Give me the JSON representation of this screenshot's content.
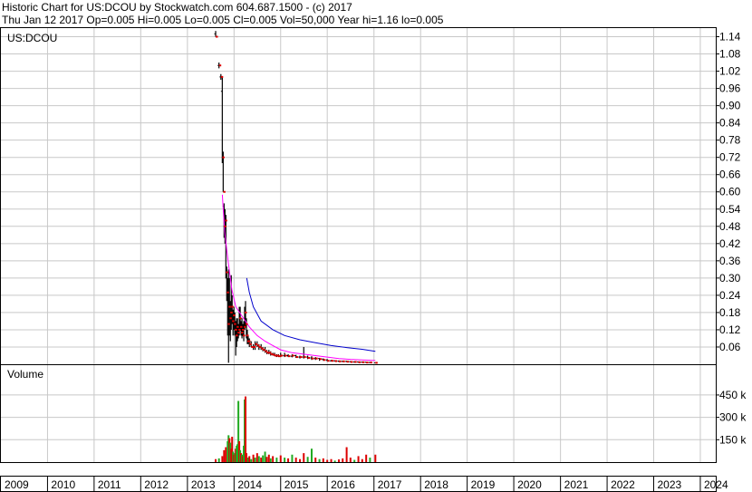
{
  "header": {
    "line1": "Historic Chart for US:DCOU by Stockwatch.com 604.687.1500 - (c) 2017",
    "line2": "Thu Jan 12 2017  Op=0.005  Hi=0.005  Lo=0.005  Cl=0.005  Vol=50,000  Year hi=1.16  lo=0.005"
  },
  "price_panel": {
    "symbol_label": "US:DCOU"
  },
  "volume_panel": {
    "label": "Volume"
  },
  "chart_data": [
    {
      "type": "line",
      "panel": "price",
      "x_axis": "date",
      "ylim": [
        0,
        1.17
      ],
      "yticks": [
        {
          "v": 0.06,
          "l": "0.06"
        },
        {
          "v": 0.12,
          "l": "0.12"
        },
        {
          "v": 0.18,
          "l": "0.18"
        },
        {
          "v": 0.24,
          "l": "0.24"
        },
        {
          "v": 0.3,
          "l": "0.30"
        },
        {
          "v": 0.36,
          "l": "0.36"
        },
        {
          "v": 0.42,
          "l": "0.42"
        },
        {
          "v": 0.48,
          "l": "0.48"
        },
        {
          "v": 0.54,
          "l": "0.54"
        },
        {
          "v": 0.6,
          "l": "0.60"
        },
        {
          "v": 0.66,
          "l": "0.66"
        },
        {
          "v": 0.72,
          "l": "0.72"
        },
        {
          "v": 0.78,
          "l": "0.78"
        },
        {
          "v": 0.84,
          "l": "0.84"
        },
        {
          "v": 0.9,
          "l": "0.90"
        },
        {
          "v": 0.96,
          "l": "0.96"
        },
        {
          "v": 1.02,
          "l": "1.02"
        },
        {
          "v": 1.08,
          "l": "1.08"
        },
        {
          "v": 1.14,
          "l": "1.14"
        }
      ],
      "grid": true,
      "bar_color": "#000000",
      "close_color": "#dd0000",
      "series": [
        {
          "name": "",
          "color": "#ff00ff",
          "points": [
            [
              "2013-10-01",
              0.59
            ],
            [
              "2013-10-20",
              0.46
            ],
            [
              "2013-11-15",
              0.36
            ],
            [
              "2013-12-15",
              0.26
            ],
            [
              "2014-01-15",
              0.2
            ],
            [
              "2014-03-01",
              0.17
            ],
            [
              "2014-05-01",
              0.13
            ],
            [
              "2014-07-01",
              0.1
            ],
            [
              "2014-09-01",
              0.08
            ],
            [
              "2014-11-01",
              0.065
            ],
            [
              "2015-01-01",
              0.05
            ],
            [
              "2015-04-01",
              0.04
            ],
            [
              "2015-07-01",
              0.035
            ],
            [
              "2015-10-01",
              0.03
            ],
            [
              "2016-01-01",
              0.025
            ],
            [
              "2016-04-01",
              0.02
            ],
            [
              "2016-07-01",
              0.017
            ],
            [
              "2016-10-01",
              0.015
            ],
            [
              "2017-01-12",
              0.013
            ]
          ]
        },
        {
          "name": "",
          "color": "#0000cc",
          "points": [
            [
              "2014-04-10",
              0.3
            ],
            [
              "2014-05-01",
              0.25
            ],
            [
              "2014-06-01",
              0.2
            ],
            [
              "2014-08-01",
              0.15
            ],
            [
              "2014-11-01",
              0.12
            ],
            [
              "2015-02-01",
              0.1
            ],
            [
              "2015-06-01",
              0.085
            ],
            [
              "2015-10-01",
              0.075
            ],
            [
              "2016-02-01",
              0.065
            ],
            [
              "2016-06-01",
              0.058
            ],
            [
              "2016-10-01",
              0.052
            ],
            [
              "2017-01-12",
              0.045
            ]
          ]
        }
      ],
      "ohlc": [
        [
          "2013-08-10",
          1.15,
          1.16,
          1.14,
          1.14
        ],
        [
          "2013-09-05",
          1.04,
          1.05,
          1.03,
          1.04
        ],
        [
          "2013-09-20",
          1.0,
          1.01,
          0.99,
          1.0
        ],
        [
          "2013-10-01",
          0.95,
          1.0,
          0.7,
          0.72
        ],
        [
          "2013-10-08",
          0.72,
          0.74,
          0.6,
          0.6
        ],
        [
          "2013-10-15",
          0.55,
          0.56,
          0.44,
          0.48
        ],
        [
          "2013-10-22",
          0.48,
          0.54,
          0.42,
          0.5
        ],
        [
          "2013-10-29",
          0.5,
          0.52,
          0.3,
          0.32
        ],
        [
          "2013-11-05",
          0.3,
          0.34,
          0.22,
          0.25
        ],
        [
          "2013-11-12",
          0.25,
          0.3,
          0.1,
          0.14
        ],
        [
          "2013-11-19",
          0.14,
          0.33,
          0.005,
          0.2
        ],
        [
          "2013-11-26",
          0.2,
          0.3,
          0.1,
          0.16
        ],
        [
          "2013-12-03",
          0.16,
          0.22,
          0.08,
          0.18
        ],
        [
          "2013-12-10",
          0.18,
          0.31,
          0.12,
          0.2
        ],
        [
          "2013-12-17",
          0.2,
          0.24,
          0.14,
          0.15
        ],
        [
          "2013-12-24",
          0.15,
          0.19,
          0.1,
          0.17
        ],
        [
          "2013-12-31",
          0.17,
          0.2,
          0.12,
          0.14
        ],
        [
          "2014-01-07",
          0.14,
          0.18,
          0.1,
          0.12
        ],
        [
          "2014-01-14",
          0.12,
          0.15,
          0.03,
          0.1
        ],
        [
          "2014-01-21",
          0.1,
          0.16,
          0.06,
          0.13
        ],
        [
          "2014-01-28",
          0.13,
          0.16,
          0.08,
          0.11
        ],
        [
          "2014-02-04",
          0.11,
          0.14,
          0.09,
          0.12
        ],
        [
          "2014-02-11",
          0.12,
          0.2,
          0.1,
          0.16
        ],
        [
          "2014-02-18",
          0.16,
          0.2,
          0.12,
          0.13
        ],
        [
          "2014-02-25",
          0.13,
          0.15,
          0.1,
          0.11
        ],
        [
          "2014-03-04",
          0.11,
          0.16,
          0.09,
          0.12
        ],
        [
          "2014-03-11",
          0.12,
          0.14,
          0.1,
          0.1
        ],
        [
          "2014-03-18",
          0.1,
          0.15,
          0.08,
          0.13
        ],
        [
          "2014-03-25",
          0.13,
          0.2,
          0.12,
          0.18
        ],
        [
          "2014-04-01",
          0.18,
          0.22,
          0.13,
          0.14
        ],
        [
          "2014-04-08",
          0.14,
          0.16,
          0.09,
          0.1
        ],
        [
          "2014-04-15",
          0.1,
          0.12,
          0.07,
          0.08
        ],
        [
          "2014-04-22",
          0.08,
          0.1,
          0.07,
          0.08
        ],
        [
          "2014-05-01",
          0.08,
          0.09,
          0.06,
          0.07
        ],
        [
          "2014-05-15",
          0.07,
          0.08,
          0.06,
          0.06
        ],
        [
          "2014-06-01",
          0.06,
          0.07,
          0.05,
          0.06
        ],
        [
          "2014-06-15",
          0.06,
          0.08,
          0.05,
          0.07
        ],
        [
          "2014-07-01",
          0.07,
          0.08,
          0.06,
          0.065
        ],
        [
          "2014-07-15",
          0.065,
          0.07,
          0.05,
          0.06
        ],
        [
          "2014-08-01",
          0.06,
          0.07,
          0.05,
          0.055
        ],
        [
          "2014-08-15",
          0.055,
          0.06,
          0.045,
          0.05
        ],
        [
          "2014-09-01",
          0.05,
          0.06,
          0.04,
          0.045
        ],
        [
          "2014-09-15",
          0.045,
          0.05,
          0.035,
          0.04
        ],
        [
          "2014-10-01",
          0.04,
          0.05,
          0.035,
          0.04
        ],
        [
          "2014-10-15",
          0.04,
          0.045,
          0.03,
          0.035
        ],
        [
          "2014-11-01",
          0.035,
          0.04,
          0.03,
          0.033
        ],
        [
          "2014-11-15",
          0.033,
          0.04,
          0.028,
          0.03
        ],
        [
          "2014-12-01",
          0.03,
          0.035,
          0.025,
          0.03
        ],
        [
          "2014-12-15",
          0.03,
          0.035,
          0.025,
          0.028
        ],
        [
          "2015-01-01",
          0.028,
          0.04,
          0.025,
          0.03
        ],
        [
          "2015-02-01",
          0.03,
          0.04,
          0.025,
          0.03
        ],
        [
          "2015-03-01",
          0.03,
          0.035,
          0.025,
          0.028
        ],
        [
          "2015-04-01",
          0.028,
          0.035,
          0.024,
          0.03
        ],
        [
          "2015-05-01",
          0.03,
          0.033,
          0.022,
          0.025
        ],
        [
          "2015-06-01",
          0.025,
          0.03,
          0.02,
          0.025
        ],
        [
          "2015-07-01",
          0.025,
          0.06,
          0.02,
          0.025
        ],
        [
          "2015-08-01",
          0.025,
          0.03,
          0.018,
          0.022
        ],
        [
          "2015-09-01",
          0.022,
          0.028,
          0.015,
          0.02
        ],
        [
          "2015-10-01",
          0.02,
          0.025,
          0.015,
          0.02
        ],
        [
          "2015-11-01",
          0.02,
          0.022,
          0.012,
          0.018
        ],
        [
          "2015-12-01",
          0.018,
          0.02,
          0.012,
          0.015
        ],
        [
          "2016-01-01",
          0.015,
          0.018,
          0.01,
          0.012
        ],
        [
          "2016-02-01",
          0.012,
          0.015,
          0.01,
          0.012
        ],
        [
          "2016-03-01",
          0.012,
          0.014,
          0.01,
          0.011
        ],
        [
          "2016-04-01",
          0.011,
          0.013,
          0.008,
          0.01
        ],
        [
          "2016-05-01",
          0.01,
          0.012,
          0.008,
          0.01
        ],
        [
          "2016-06-01",
          0.01,
          0.012,
          0.008,
          0.009
        ],
        [
          "2016-07-01",
          0.009,
          0.011,
          0.007,
          0.008
        ],
        [
          "2016-08-01",
          0.008,
          0.01,
          0.006,
          0.008
        ],
        [
          "2016-09-01",
          0.008,
          0.009,
          0.006,
          0.007
        ],
        [
          "2016-10-01",
          0.007,
          0.009,
          0.006,
          0.007
        ],
        [
          "2016-11-01",
          0.007,
          0.008,
          0.005,
          0.006
        ],
        [
          "2016-12-01",
          0.006,
          0.008,
          0.005,
          0.006
        ],
        [
          "2017-01-12",
          0.005,
          0.005,
          0.005,
          0.005
        ]
      ]
    },
    {
      "type": "bar",
      "panel": "volume",
      "x_axis": "date",
      "ylim": [
        0,
        650000
      ],
      "yticks": [
        {
          "v": 150000,
          "l": "150 k"
        },
        {
          "v": 300000,
          "l": "300 k"
        },
        {
          "v": 450000,
          "l": "450 k"
        }
      ],
      "up_color": "#22aa22",
      "down_color": "#dd0000",
      "bars": [
        [
          "2013-08-10",
          20000,
          "d"
        ],
        [
          "2013-09-05",
          25000,
          "u"
        ],
        [
          "2013-10-01",
          40000,
          "d"
        ],
        [
          "2013-10-15",
          80000,
          "d"
        ],
        [
          "2013-10-29",
          100000,
          "d"
        ],
        [
          "2013-11-12",
          140000,
          "u"
        ],
        [
          "2013-11-19",
          180000,
          "u"
        ],
        [
          "2013-11-26",
          160000,
          "d"
        ],
        [
          "2013-12-03",
          130000,
          "u"
        ],
        [
          "2013-12-10",
          90000,
          "d"
        ],
        [
          "2013-12-17",
          170000,
          "d"
        ],
        [
          "2013-12-24",
          70000,
          "u"
        ],
        [
          "2013-12-31",
          50000,
          "d"
        ],
        [
          "2014-01-07",
          60000,
          "u"
        ],
        [
          "2014-01-14",
          90000,
          "d"
        ],
        [
          "2014-01-21",
          110000,
          "u"
        ],
        [
          "2014-01-28",
          120000,
          "u"
        ],
        [
          "2014-02-04",
          410000,
          "u"
        ],
        [
          "2014-02-11",
          140000,
          "d"
        ],
        [
          "2014-02-18",
          80000,
          "u"
        ],
        [
          "2014-02-25",
          60000,
          "d"
        ],
        [
          "2014-03-04",
          50000,
          "u"
        ],
        [
          "2014-03-11",
          40000,
          "d"
        ],
        [
          "2014-03-18",
          110000,
          "u"
        ],
        [
          "2014-03-25",
          420000,
          "u"
        ],
        [
          "2014-04-01",
          440000,
          "d"
        ],
        [
          "2014-04-08",
          60000,
          "d"
        ],
        [
          "2014-04-22",
          30000,
          "u"
        ],
        [
          "2014-05-01",
          40000,
          "d"
        ],
        [
          "2014-05-15",
          20000,
          "u"
        ],
        [
          "2014-06-01",
          50000,
          "d"
        ],
        [
          "2014-06-15",
          30000,
          "u"
        ],
        [
          "2014-07-01",
          60000,
          "d"
        ],
        [
          "2014-07-15",
          40000,
          "u"
        ],
        [
          "2014-08-01",
          30000,
          "d"
        ],
        [
          "2014-08-15",
          45000,
          "u"
        ],
        [
          "2014-09-01",
          70000,
          "u"
        ],
        [
          "2014-09-15",
          35000,
          "d"
        ],
        [
          "2014-10-01",
          50000,
          "d"
        ],
        [
          "2014-10-15",
          25000,
          "u"
        ],
        [
          "2014-11-01",
          40000,
          "d"
        ],
        [
          "2014-12-01",
          30000,
          "u"
        ],
        [
          "2015-01-01",
          45000,
          "d"
        ],
        [
          "2015-02-01",
          30000,
          "u"
        ],
        [
          "2015-03-01",
          25000,
          "d"
        ],
        [
          "2015-04-01",
          50000,
          "u"
        ],
        [
          "2015-05-01",
          30000,
          "d"
        ],
        [
          "2015-06-01",
          20000,
          "d"
        ],
        [
          "2015-07-01",
          60000,
          "d"
        ],
        [
          "2015-08-01",
          35000,
          "u"
        ],
        [
          "2015-09-01",
          90000,
          "u"
        ],
        [
          "2015-10-01",
          30000,
          "d"
        ],
        [
          "2015-11-01",
          20000,
          "u"
        ],
        [
          "2015-12-01",
          25000,
          "d"
        ],
        [
          "2016-01-01",
          15000,
          "d"
        ],
        [
          "2016-02-01",
          20000,
          "d"
        ],
        [
          "2016-03-01",
          10000,
          "u"
        ],
        [
          "2016-04-01",
          18000,
          "d"
        ],
        [
          "2016-05-01",
          25000,
          "d"
        ],
        [
          "2016-06-01",
          100000,
          "d"
        ],
        [
          "2016-07-01",
          30000,
          "d"
        ],
        [
          "2016-08-01",
          15000,
          "u"
        ],
        [
          "2016-09-01",
          40000,
          "d"
        ],
        [
          "2016-10-01",
          20000,
          "d"
        ],
        [
          "2016-11-01",
          50000,
          "d"
        ],
        [
          "2016-12-01",
          30000,
          "u"
        ],
        [
          "2017-01-12",
          50000,
          "d"
        ]
      ]
    }
  ],
  "x_axis": {
    "domain": [
      "2009-01-01",
      "2024-05-01"
    ],
    "years": [
      "2009",
      "2010",
      "2011",
      "2012",
      "2013",
      "2014",
      "2015",
      "2016",
      "2017",
      "2018",
      "2019",
      "2020",
      "2021",
      "2022",
      "2023",
      "2024"
    ]
  }
}
